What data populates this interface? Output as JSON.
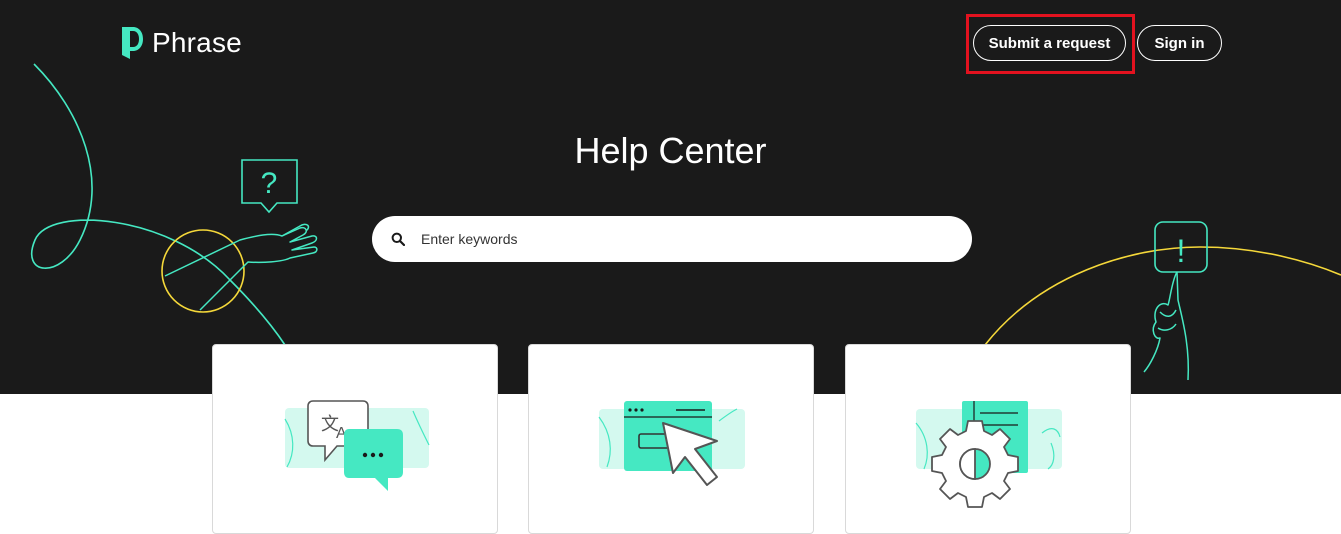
{
  "brand": {
    "name": "Phrase",
    "accent": "#45e8c2",
    "yellow": "#f5d83a"
  },
  "header": {
    "submit_request_label": "Submit a request",
    "sign_in_label": "Sign in"
  },
  "hero": {
    "title": "Help Center",
    "background": "#1a1a1a"
  },
  "search": {
    "placeholder": "Enter keywords",
    "value": ""
  },
  "cards": [
    {
      "icon": "translation-chat-icon"
    },
    {
      "icon": "browser-cursor-icon"
    },
    {
      "icon": "gear-settings-icon"
    }
  ],
  "highlight_color": "#e3121f"
}
